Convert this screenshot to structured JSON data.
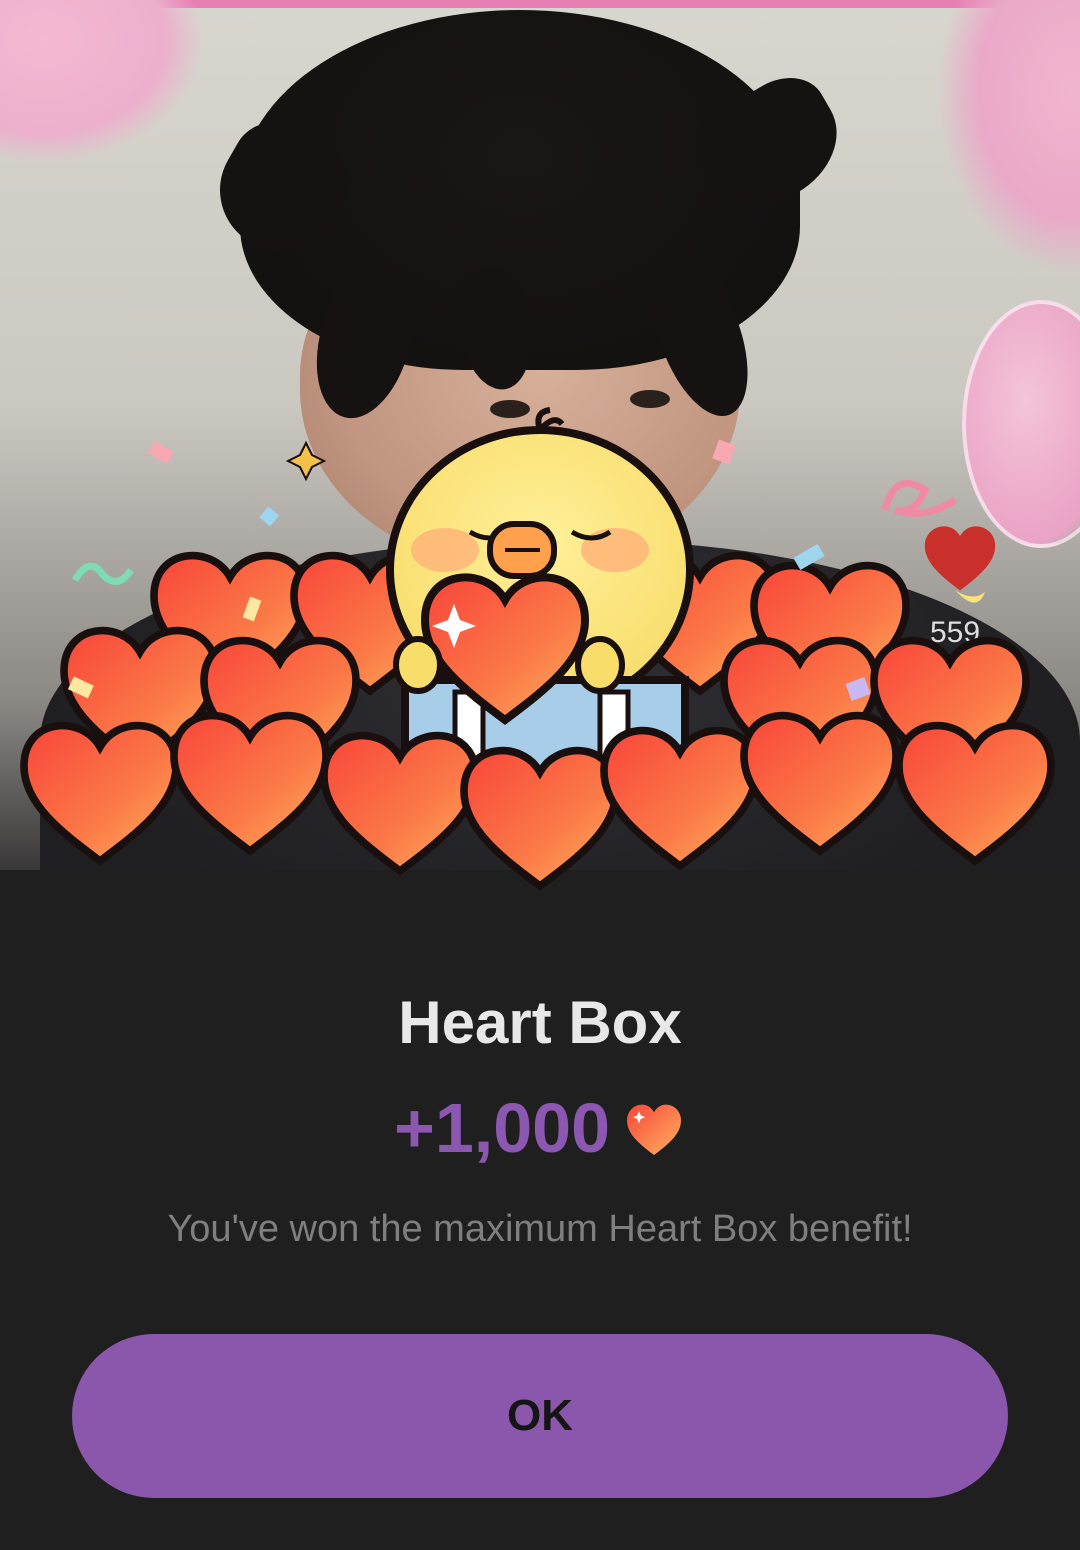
{
  "background": {
    "heart_count": "559",
    "count_icon": "heart-icon"
  },
  "popup": {
    "illustration": "chick-holding-heart-on-heart-pile",
    "title": "Heart Box",
    "reward_amount": "+1,000",
    "reward_icon": "heart-icon",
    "message": "You've won the maximum Heart Box benefit!",
    "ok_label": "OK"
  },
  "colors": {
    "accent_purple": "#8b57ad",
    "reward_text": "#8b57b0",
    "sheet_bg": "#1f1f1f",
    "heart_orange": "#f8653f",
    "heart_light": "#ffa95a"
  }
}
